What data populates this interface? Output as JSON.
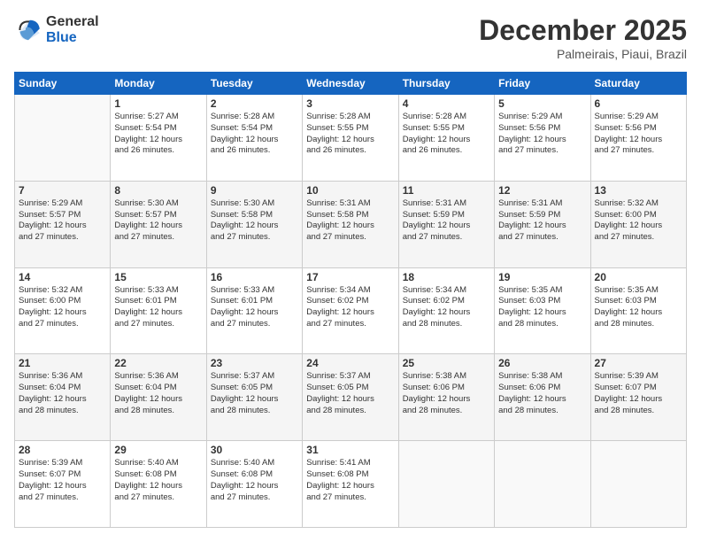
{
  "logo": {
    "general": "General",
    "blue": "Blue"
  },
  "title": {
    "month": "December 2025",
    "location": "Palmeirais, Piaui, Brazil"
  },
  "weekdays": [
    "Sunday",
    "Monday",
    "Tuesday",
    "Wednesday",
    "Thursday",
    "Friday",
    "Saturday"
  ],
  "weeks": [
    [
      {
        "day": "",
        "info": ""
      },
      {
        "day": "1",
        "info": "Sunrise: 5:27 AM\nSunset: 5:54 PM\nDaylight: 12 hours\nand 26 minutes."
      },
      {
        "day": "2",
        "info": "Sunrise: 5:28 AM\nSunset: 5:54 PM\nDaylight: 12 hours\nand 26 minutes."
      },
      {
        "day": "3",
        "info": "Sunrise: 5:28 AM\nSunset: 5:55 PM\nDaylight: 12 hours\nand 26 minutes."
      },
      {
        "day": "4",
        "info": "Sunrise: 5:28 AM\nSunset: 5:55 PM\nDaylight: 12 hours\nand 26 minutes."
      },
      {
        "day": "5",
        "info": "Sunrise: 5:29 AM\nSunset: 5:56 PM\nDaylight: 12 hours\nand 27 minutes."
      },
      {
        "day": "6",
        "info": "Sunrise: 5:29 AM\nSunset: 5:56 PM\nDaylight: 12 hours\nand 27 minutes."
      }
    ],
    [
      {
        "day": "7",
        "info": "Sunrise: 5:29 AM\nSunset: 5:57 PM\nDaylight: 12 hours\nand 27 minutes."
      },
      {
        "day": "8",
        "info": "Sunrise: 5:30 AM\nSunset: 5:57 PM\nDaylight: 12 hours\nand 27 minutes."
      },
      {
        "day": "9",
        "info": "Sunrise: 5:30 AM\nSunset: 5:58 PM\nDaylight: 12 hours\nand 27 minutes."
      },
      {
        "day": "10",
        "info": "Sunrise: 5:31 AM\nSunset: 5:58 PM\nDaylight: 12 hours\nand 27 minutes."
      },
      {
        "day": "11",
        "info": "Sunrise: 5:31 AM\nSunset: 5:59 PM\nDaylight: 12 hours\nand 27 minutes."
      },
      {
        "day": "12",
        "info": "Sunrise: 5:31 AM\nSunset: 5:59 PM\nDaylight: 12 hours\nand 27 minutes."
      },
      {
        "day": "13",
        "info": "Sunrise: 5:32 AM\nSunset: 6:00 PM\nDaylight: 12 hours\nand 27 minutes."
      }
    ],
    [
      {
        "day": "14",
        "info": "Sunrise: 5:32 AM\nSunset: 6:00 PM\nDaylight: 12 hours\nand 27 minutes."
      },
      {
        "day": "15",
        "info": "Sunrise: 5:33 AM\nSunset: 6:01 PM\nDaylight: 12 hours\nand 27 minutes."
      },
      {
        "day": "16",
        "info": "Sunrise: 5:33 AM\nSunset: 6:01 PM\nDaylight: 12 hours\nand 27 minutes."
      },
      {
        "day": "17",
        "info": "Sunrise: 5:34 AM\nSunset: 6:02 PM\nDaylight: 12 hours\nand 27 minutes."
      },
      {
        "day": "18",
        "info": "Sunrise: 5:34 AM\nSunset: 6:02 PM\nDaylight: 12 hours\nand 28 minutes."
      },
      {
        "day": "19",
        "info": "Sunrise: 5:35 AM\nSunset: 6:03 PM\nDaylight: 12 hours\nand 28 minutes."
      },
      {
        "day": "20",
        "info": "Sunrise: 5:35 AM\nSunset: 6:03 PM\nDaylight: 12 hours\nand 28 minutes."
      }
    ],
    [
      {
        "day": "21",
        "info": "Sunrise: 5:36 AM\nSunset: 6:04 PM\nDaylight: 12 hours\nand 28 minutes."
      },
      {
        "day": "22",
        "info": "Sunrise: 5:36 AM\nSunset: 6:04 PM\nDaylight: 12 hours\nand 28 minutes."
      },
      {
        "day": "23",
        "info": "Sunrise: 5:37 AM\nSunset: 6:05 PM\nDaylight: 12 hours\nand 28 minutes."
      },
      {
        "day": "24",
        "info": "Sunrise: 5:37 AM\nSunset: 6:05 PM\nDaylight: 12 hours\nand 28 minutes."
      },
      {
        "day": "25",
        "info": "Sunrise: 5:38 AM\nSunset: 6:06 PM\nDaylight: 12 hours\nand 28 minutes."
      },
      {
        "day": "26",
        "info": "Sunrise: 5:38 AM\nSunset: 6:06 PM\nDaylight: 12 hours\nand 28 minutes."
      },
      {
        "day": "27",
        "info": "Sunrise: 5:39 AM\nSunset: 6:07 PM\nDaylight: 12 hours\nand 28 minutes."
      }
    ],
    [
      {
        "day": "28",
        "info": "Sunrise: 5:39 AM\nSunset: 6:07 PM\nDaylight: 12 hours\nand 27 minutes."
      },
      {
        "day": "29",
        "info": "Sunrise: 5:40 AM\nSunset: 6:08 PM\nDaylight: 12 hours\nand 27 minutes."
      },
      {
        "day": "30",
        "info": "Sunrise: 5:40 AM\nSunset: 6:08 PM\nDaylight: 12 hours\nand 27 minutes."
      },
      {
        "day": "31",
        "info": "Sunrise: 5:41 AM\nSunset: 6:08 PM\nDaylight: 12 hours\nand 27 minutes."
      },
      {
        "day": "",
        "info": ""
      },
      {
        "day": "",
        "info": ""
      },
      {
        "day": "",
        "info": ""
      }
    ]
  ]
}
